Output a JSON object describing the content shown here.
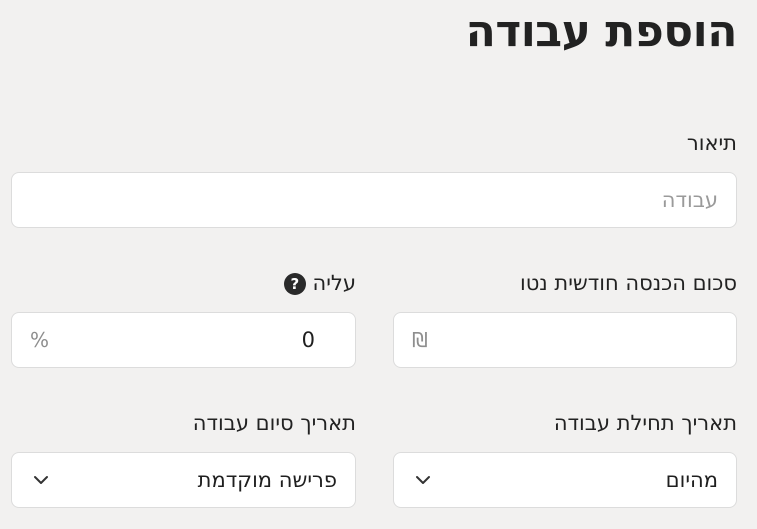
{
  "page": {
    "title": "הוספת עבודה"
  },
  "description": {
    "label": "תיאור",
    "placeholder": "עבודה"
  },
  "monthly_income": {
    "label": "סכום הכנסה חודשית נטו",
    "currency_symbol": "₪",
    "value": ""
  },
  "raise": {
    "label": "עליה",
    "help_icon": "question-circle-icon",
    "value": "0",
    "suffix": "%"
  },
  "start_date": {
    "label": "תאריך תחילת עבודה",
    "selected": "מהיום"
  },
  "end_date": {
    "label": "תאריך סיום עבודה",
    "selected": "פרישה מוקדמת"
  }
}
